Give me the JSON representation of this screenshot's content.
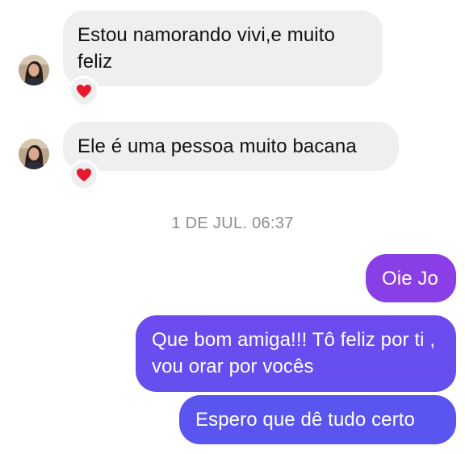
{
  "conversation": {
    "messages_in": [
      {
        "text": "Estou namorando vivi,e muito feliz",
        "reaction": "heart-emoji"
      },
      {
        "text": "Ele é uma pessoa muito bacana",
        "reaction": "heart-emoji"
      }
    ],
    "timestamp": "1 DE JUL. 06:37",
    "messages_out": [
      {
        "text": "Oie Jo"
      },
      {
        "text": "Que bom amiga!!! Tô feliz por ti , vou orar por vocês"
      },
      {
        "text": "Espero que dê tudo certo"
      }
    ]
  },
  "colors": {
    "incoming_bubble": "#efeff0",
    "outgoing_top": "#8a3fe6",
    "outgoing_mid": "#6a4cef",
    "outgoing_bottom": "#5a55ee",
    "heart": "#e8192c",
    "timestamp_text": "#8e8e93"
  }
}
